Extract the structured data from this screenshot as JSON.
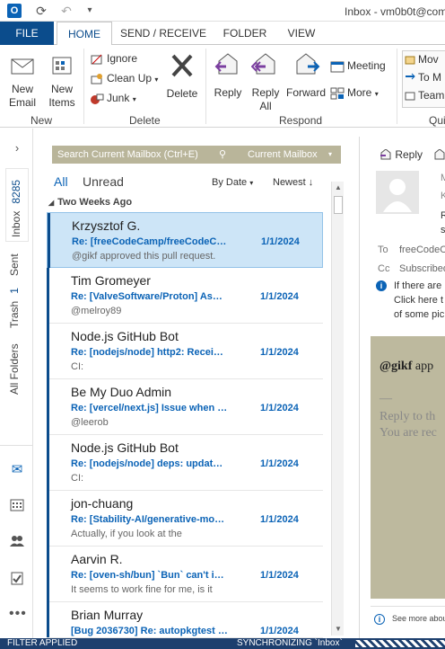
{
  "window": {
    "title": "Inbox - vm0b0t@com"
  },
  "ribbon_tabs": [
    "FILE",
    "HOME",
    "SEND / RECEIVE",
    "FOLDER",
    "VIEW"
  ],
  "ribbon": {
    "new_group": {
      "new_email": "New\nEmail",
      "new_items": "New\nItems",
      "label": "New"
    },
    "delete_group": {
      "ignore": "Ignore",
      "clean_up": "Clean Up",
      "junk": "Junk",
      "delete": "Delete",
      "label": "Delete"
    },
    "respond_group": {
      "reply": "Reply",
      "reply_all": "Reply\nAll",
      "forward": "Forward",
      "meeting": "Meeting",
      "more": "More",
      "label": "Respond"
    },
    "quick_group": {
      "move": "Mov",
      "to_m": "To M",
      "team": "Team",
      "label": "Qui"
    }
  },
  "leftnav": {
    "inbox_label": "Inbox",
    "inbox_count": "8285",
    "sent_label": "Sent",
    "trash_label": "Trash",
    "trash_count": "1",
    "all_folders": "All Folders"
  },
  "list": {
    "search_placeholder": "Search Current Mailbox (Ctrl+E)",
    "search_scope": "Current Mailbox",
    "filter_all": "All",
    "filter_unread": "Unread",
    "sort_by": "By Date",
    "sort_order": "Newest",
    "group_header": "Two Weeks Ago",
    "messages": [
      {
        "sender": "Krzysztof G.",
        "subject": "Re: [freeCodeCamp/freeCodeCamp] ...",
        "date": "1/1/2024",
        "preview": "@gikf approved this pull request."
      },
      {
        "sender": "Tim Gromeyer",
        "subject": "Re: [ValveSoftware/Proton] Assetto ...",
        "date": "1/1/2024",
        "preview": "@melroy89"
      },
      {
        "sender": "Node.js GitHub Bot",
        "subject": "Re: [nodejs/node] http2: Receive ...",
        "date": "1/1/2024",
        "preview": "CI:"
      },
      {
        "sender": "Be My Duo Admin",
        "subject": "Re: [vercel/next.js] Issue when re...",
        "date": "1/1/2024",
        "preview": "@leerob"
      },
      {
        "sender": "Node.js GitHub Bot",
        "subject": "Re: [nodejs/node] deps: update ...",
        "date": "1/1/2024",
        "preview": "CI:"
      },
      {
        "sender": "jon-chuang",
        "subject": "Re: [Stability-AI/generative-mode...",
        "date": "1/1/2024",
        "preview": "Actually, if you look at the"
      },
      {
        "sender": "Aarvin R.",
        "subject": "Re: [oven-sh/bun] `Bun` can't ins...",
        "date": "1/1/2024",
        "preview": "It seems to work fine for me, is it"
      },
      {
        "sender": "Brian Murray",
        "subject": "[Bug 2036730] Re: autopkgtest ig...",
        "date": "1/1/2024",
        "preview": ""
      }
    ]
  },
  "reading": {
    "reply_label": "Reply",
    "to_label": "To",
    "to_value": "freeCodeC",
    "cc_label": "Cc",
    "cc_value": "Subscribed",
    "info1": "If there are",
    "info2": "Click here t",
    "info3": "of some pic",
    "body_author": "@gikf",
    "body_rest": " app",
    "dash": "—",
    "reply_to": "Reply to th",
    "you_are": "You are rec",
    "see_more": "See more abou",
    "initials_r": "R",
    "initials_s": "s",
    "initials_m": "M",
    "initials_k": "K"
  },
  "status": {
    "left": "FILTER APPLIED",
    "right": "SYNCHRONIZING `Inbox`"
  },
  "colors": {
    "accent": "#0b4c8c",
    "link": "#0b63b6",
    "selection": "#cde5f7",
    "search_bg": "#b9b59a",
    "reading_bg": "#bdb99e",
    "status_bg": "#1d3f6e"
  }
}
